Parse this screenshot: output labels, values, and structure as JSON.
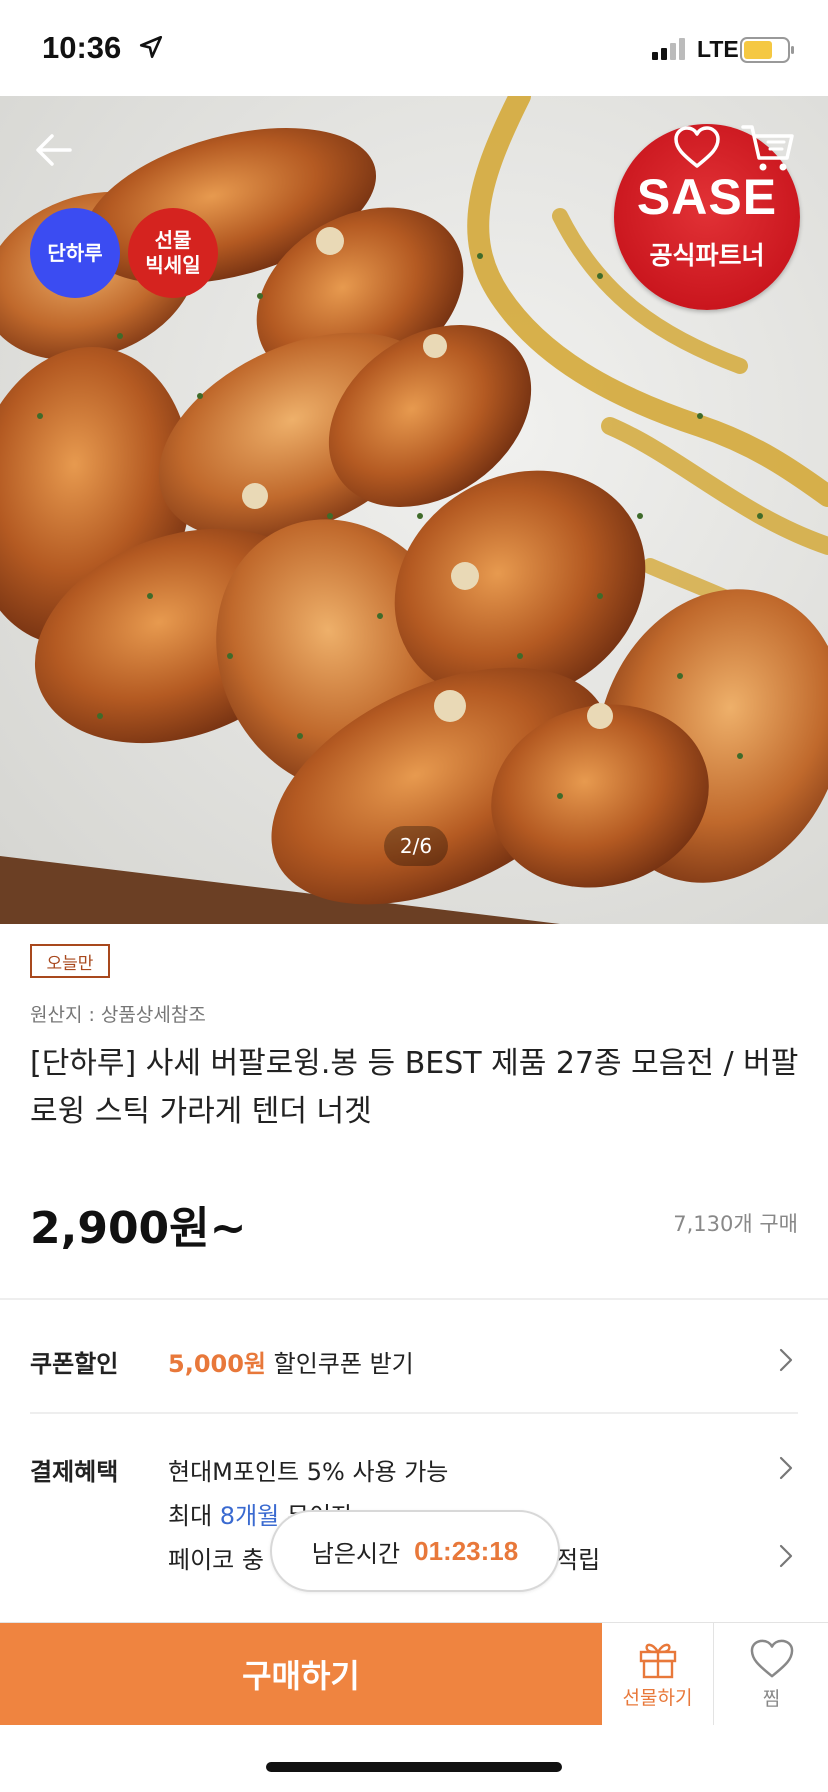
{
  "status_bar": {
    "time": "10:36",
    "network": "LTE"
  },
  "hero": {
    "badge_danharu": "단하루",
    "badge_gift_line1": "선물",
    "badge_gift_line2": "빅세일",
    "seal_brand": "SASE",
    "seal_sub": "공식파트너",
    "page_indicator": "2/6"
  },
  "product": {
    "today_tag": "오늘만",
    "origin": "원산지 : 상품상세참조",
    "title": "[단하루] 사세 버팔로윙.봉 등 BEST 제품 27종 모음전 / 버팔로윙 스틱 가라게 텐더 너겟",
    "price": "2,900원~",
    "purchase_count": "7,130개 구매"
  },
  "coupon": {
    "label": "쿠폰할인",
    "amount": "5,000원",
    "text": " 할인쿠폰 받기"
  },
  "payment": {
    "label": "결제혜택",
    "line1": "현대M포인트 5% 사용 가능",
    "line2_prefix": "최대 ",
    "line2_highlight": "8개월",
    "line2_suffix": " 무이자",
    "line3_prefix": "페이코 충",
    "line3_suffix": "적립"
  },
  "timer": {
    "label": "남은시간",
    "value": "01:23:18"
  },
  "bottom_bar": {
    "buy": "구매하기",
    "gift": "선물하기",
    "zzim": "찜"
  }
}
